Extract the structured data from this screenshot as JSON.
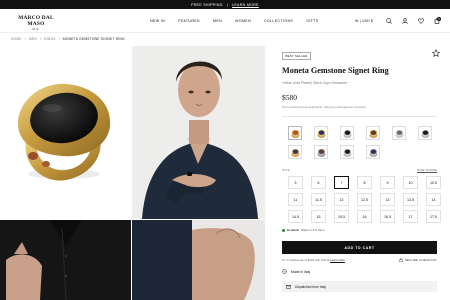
{
  "announcement": {
    "text": "FREE SHIPPING",
    "sep": "|",
    "link": "LEARN MORE"
  },
  "brand": {
    "name": "MARCO DAL MASO",
    "sub": "M.S."
  },
  "nav": [
    "NEW IN",
    "FEATURED",
    "MEN",
    "WOMEN",
    "COLLECTIONS",
    "GIFTS"
  ],
  "header": {
    "region": "IN | USD $",
    "cart_count": "0"
  },
  "breadcrumb": [
    "HOME",
    "MEN",
    "RINGS",
    "MONETA GEMSTONE SIGNET RING"
  ],
  "breadcrumb_sep": "/",
  "product": {
    "badge": "BEST SELLER",
    "title": "Moneta Gemstone Signet Ring",
    "subtitle": "Yellow Gold Plated | Black Onyx Gemstone",
    "price": "$580",
    "tax_note": "Tax included where applicable. Shipping calculated at checkout.",
    "size_label": "SIZE",
    "size_guide": "SIZE GUIDE",
    "sizes": [
      "5",
      "6",
      "7",
      "8",
      "9",
      "10",
      "10.5",
      "11",
      "11.5",
      "12",
      "12.5",
      "13",
      "13.5",
      "14",
      "14.5",
      "15",
      "15.5",
      "16",
      "16.5",
      "17",
      "17.5"
    ],
    "selected_size": "7",
    "stock_status": "In stock",
    "stock_detail": "Ships in 3-5 days",
    "add_to_cart": "ADD TO CART",
    "pay_note": "Or 4 installments of $145 with Klarna",
    "learn_more": "Learn more",
    "secure_checkout": "SECURE CHECKOUT",
    "made_in": "Made in Italy",
    "dispatched": "Dispatched from Italy"
  },
  "swatches": [
    {
      "metal": "#c9a04d",
      "stone": "#b3542a"
    },
    {
      "metal": "#c9a04d",
      "stone": "#2d2f6b"
    },
    {
      "metal": "#b9b9b9",
      "stone": "#161616"
    },
    {
      "metal": "#c9a04d",
      "stone": "#5a3a2a"
    },
    {
      "metal": "#c7c7c7",
      "stone": "#6b6b6b"
    },
    {
      "metal": "#b9b9b9",
      "stone": "#1a1a1a"
    },
    {
      "metal": "#c9a04d",
      "stone": "#33366f"
    },
    {
      "metal": "#9a9a9a",
      "stone": "#5a4032"
    },
    {
      "metal": "#bdbdbd",
      "stone": "#1c1c1c"
    },
    {
      "metal": "#a9a9a9",
      "stone": "#2a2e63"
    }
  ],
  "selected_swatch": 0,
  "colors": {
    "accent": "#111111",
    "stock": "#2f8a3b"
  }
}
